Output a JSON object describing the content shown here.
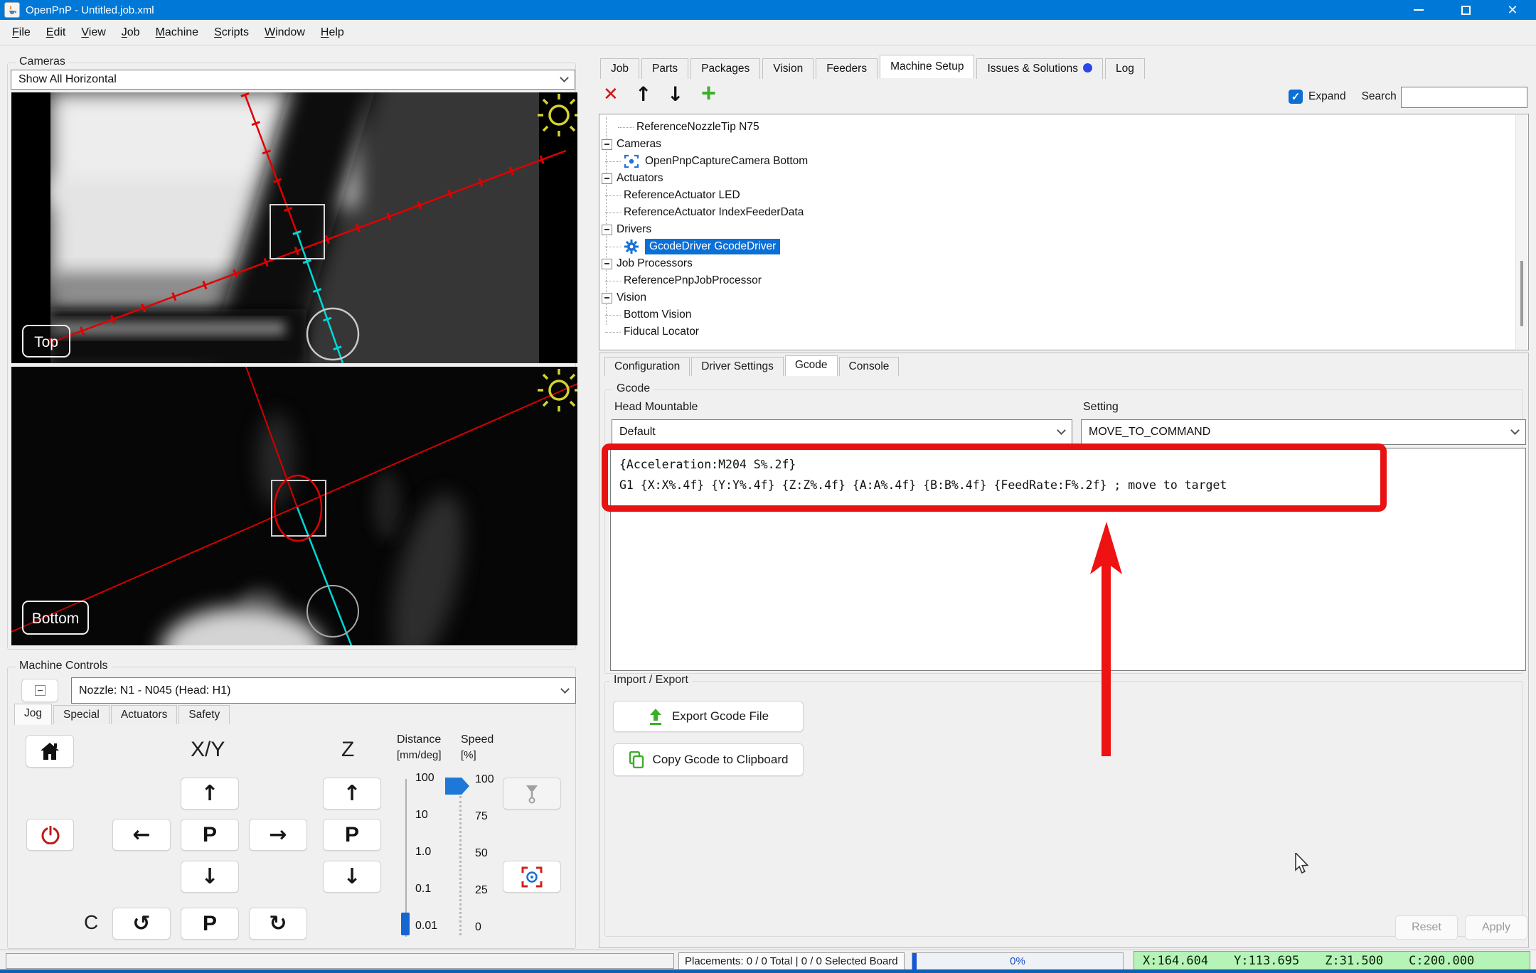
{
  "colors": {
    "titlebar_blue": "#0078d7",
    "selection_blue": "#0a6fd6",
    "annotation_red": "#e81212",
    "crosshair_red": "#e00000",
    "crosshair_cyan": "#00d8d8",
    "sun_yellow": "#d2d22e",
    "green_icon": "#3dae2b",
    "coord_bg": "#b6f3b6",
    "issues_dot": "#2b46e8"
  },
  "titlebar": {
    "title": "OpenPnP - Untitled.job.xml"
  },
  "menubar": {
    "items": [
      "File",
      "Edit",
      "View",
      "Job",
      "Machine",
      "Scripts",
      "Window",
      "Help"
    ]
  },
  "cameras": {
    "group_label": "Cameras",
    "view_selector": "Show All Horizontal",
    "top_badge": "Top",
    "bottom_badge": "Bottom"
  },
  "machine_controls": {
    "group_label": "Machine Controls",
    "selected_tool": "Nozzle: N1 - N045 (Head: H1)",
    "tabs": [
      "Jog",
      "Special",
      "Actuators",
      "Safety"
    ],
    "active_tab": "Jog",
    "xy_label": "X/Y",
    "z_label": "Z",
    "p_label": "P",
    "rotate_label": "C",
    "distance": {
      "label": "Distance",
      "unit": "[mm/deg]",
      "ticks": [
        "100",
        "10",
        "1.0",
        "0.1",
        "0.01"
      ],
      "value": "0.01"
    },
    "speed": {
      "label": "Speed",
      "unit": "[%]",
      "ticks": [
        "100",
        "75",
        "50",
        "25",
        "0"
      ],
      "value": "100"
    }
  },
  "right_tabs": {
    "items": [
      "Job",
      "Parts",
      "Packages",
      "Vision",
      "Feeders",
      "Machine Setup",
      "Issues & Solutions",
      "Log"
    ],
    "active": "Machine Setup"
  },
  "tree_toolbar": {
    "expand_label": "Expand",
    "expand_checked": true,
    "search_label": "Search",
    "search_value": ""
  },
  "machine_tree": {
    "items": [
      {
        "label": "ReferenceNozzleTip N75"
      },
      {
        "label": "Cameras"
      },
      {
        "label": "OpenPnpCaptureCamera Bottom"
      },
      {
        "label": "Actuators"
      },
      {
        "label": "ReferenceActuator LED"
      },
      {
        "label": "ReferenceActuator IndexFeederData"
      },
      {
        "label": "Drivers"
      },
      {
        "label": "GcodeDriver GcodeDriver",
        "selected": true
      },
      {
        "label": "Job Processors"
      },
      {
        "label": "ReferencePnpJobProcessor"
      },
      {
        "label": "Vision"
      },
      {
        "label": "Bottom Vision"
      },
      {
        "label": "Fiducal Locator"
      }
    ]
  },
  "properties": {
    "tabs": [
      "Configuration",
      "Driver Settings",
      "Gcode",
      "Console"
    ],
    "active_tab": "Gcode",
    "gcode_group_label": "Gcode",
    "head_mountable_label": "Head Mountable",
    "head_mountable_value": "Default",
    "setting_label": "Setting",
    "setting_value": "MOVE_TO_COMMAND",
    "gcode_lines": [
      "{Acceleration:M204 S%.2f}",
      "G1 {X:X%.4f} {Y:Y%.4f} {Z:Z%.4f} {A:A%.4f} {B:B%.4f} {FeedRate:F%.2f} ; move to target"
    ],
    "import_export_label": "Import / Export",
    "export_button": "Export Gcode File",
    "copy_button": "Copy Gcode to Clipboard",
    "reset_button": "Reset",
    "apply_button": "Apply"
  },
  "statusbar": {
    "placements": "Placements: 0 / 0 Total | 0 / 0 Selected Board",
    "progress": "0%",
    "coords": {
      "x": "X:164.604",
      "y": "Y:113.695",
      "z": "Z:31.500",
      "c": "C:200.000"
    }
  }
}
